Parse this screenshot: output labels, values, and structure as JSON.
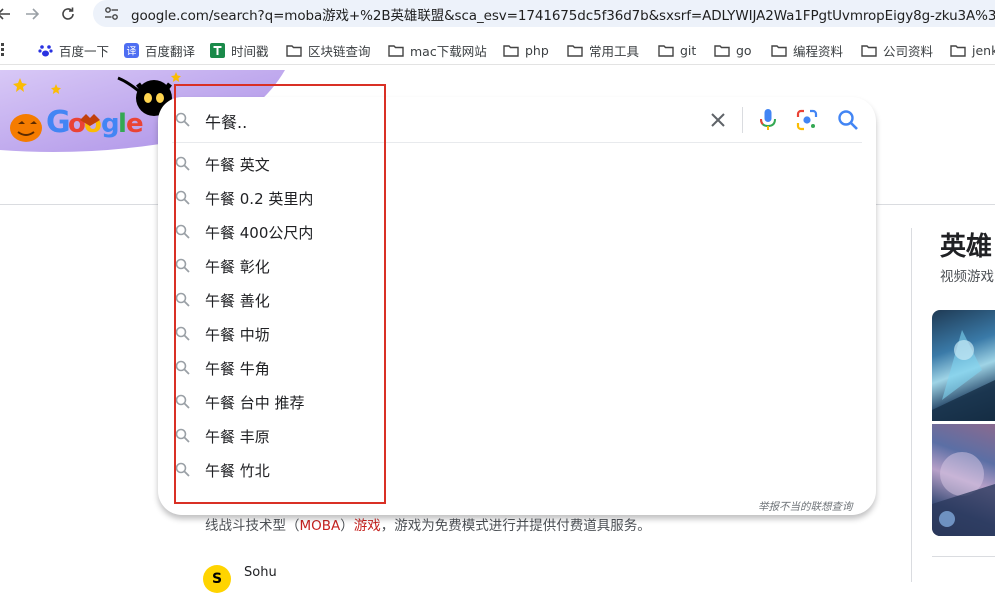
{
  "browser": {
    "url": "google.com/search?q=moba游戏+%2B英雄联盟&sca_esv=1741675dc5f36d7b&sxsrf=ADLYWIJA2Wa1FPgtUvmropEigy8g-zku3A%3",
    "bookmarks": [
      {
        "label": "百度一下",
        "icon": "paw-icon"
      },
      {
        "label": "百度翻译",
        "icon": "translate-icon"
      },
      {
        "label": "时间戳",
        "icon": "green-t-icon"
      },
      {
        "label": "区块链查询",
        "icon": "folder-icon"
      },
      {
        "label": "mac下载网站",
        "icon": "folder-icon"
      },
      {
        "label": "php",
        "icon": "folder-icon"
      },
      {
        "label": "常用工具",
        "icon": "folder-icon"
      },
      {
        "label": "git",
        "icon": "folder-icon"
      },
      {
        "label": "go",
        "icon": "folder-icon"
      },
      {
        "label": "编程资料",
        "icon": "folder-icon"
      },
      {
        "label": "公司资料",
        "icon": "folder-icon"
      },
      {
        "label": "jenk",
        "icon": "folder-icon"
      }
    ]
  },
  "search": {
    "query": "午餐..",
    "suggestions": [
      "午餐 英文",
      "午餐 0.2 英里内",
      "午餐 400公尺内",
      "午餐 彰化",
      "午餐 善化",
      "午餐 中坜",
      "午餐 牛角",
      "午餐 台中 推荐",
      "午餐 丰原",
      "午餐 竹北"
    ],
    "report_link": "举报不当的联想查询"
  },
  "result": {
    "snippet_before": "线战斗技术型（",
    "snippet_em1": "MOBA",
    "snippet_mid": "）",
    "snippet_em2": "游戏",
    "snippet_after": "，游戏为免费模式进行并提供付费道具服务。",
    "source_name": "Sohu",
    "source_logo": "S"
  },
  "knowledge_panel": {
    "title": "英雄",
    "subtitle": "视频游戏"
  },
  "colors": {
    "highlight_box": "#d93025",
    "google_blue": "#4285f4",
    "google_red": "#ea4335",
    "google_yellow": "#fbbc04",
    "google_green": "#34a853"
  }
}
